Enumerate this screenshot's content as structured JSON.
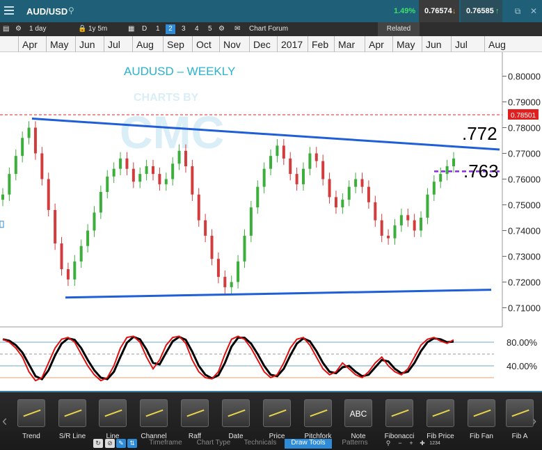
{
  "titlebar": {
    "symbol": "AUD/USD",
    "change": "1.49%",
    "bid": "0.76574",
    "ask": "0.76585"
  },
  "toolbar": {
    "timeframe": "1 day",
    "range": "1y 5m",
    "period_d": "D",
    "period_1": "1",
    "period_2": "2",
    "period_3": "3",
    "period_4": "4",
    "period_5": "5",
    "chart_forum": "Chart Forum",
    "related": "Related"
  },
  "months": [
    "Apr",
    "May",
    "Jun",
    "Jul",
    "Aug",
    "Sep",
    "Oct",
    "Nov",
    "Dec",
    "2017",
    "Feb",
    "Mar",
    "Apr",
    "May",
    "Jun",
    "Jul",
    "Aug"
  ],
  "chart": {
    "title": "AUDUSD – WEEKLY",
    "watermark": "CHARTS BY",
    "watermark_logo": "CMC",
    "annotation_upper": ".772",
    "annotation_lower": ".763",
    "current_price_label": "0.78501",
    "y_labels": [
      "0.80000",
      "0.79000",
      "0.78000",
      "0.77000",
      "0.76000",
      "0.75000",
      "0.74000",
      "0.73000",
      "0.72000",
      "0.71000"
    ],
    "osc_labels": [
      "80.00%",
      "40.00%"
    ],
    "colors": {
      "trendline": "#1e5fd8",
      "support_dashed": "#8a2be2",
      "bull": "#3cae3c",
      "bear": "#d23c3c",
      "price_line": "#e02020"
    }
  },
  "chart_data": {
    "type": "candlestick",
    "title": "AUDUSD – WEEKLY",
    "ylim": [
      0.705,
      0.805
    ],
    "resistance_line": {
      "start": 0.7835,
      "end": 0.7715
    },
    "support_line": {
      "start": 0.714,
      "end": 0.717
    },
    "dashed_level": 0.763,
    "current_price": 0.78501,
    "closes": [
      0.754,
      0.762,
      0.769,
      0.776,
      0.78,
      0.77,
      0.76,
      0.748,
      0.735,
      0.725,
      0.721,
      0.728,
      0.734,
      0.74,
      0.747,
      0.755,
      0.761,
      0.764,
      0.768,
      0.764,
      0.759,
      0.762,
      0.765,
      0.762,
      0.758,
      0.76,
      0.766,
      0.771,
      0.765,
      0.754,
      0.744,
      0.738,
      0.729,
      0.722,
      0.718,
      0.72,
      0.728,
      0.738,
      0.749,
      0.757,
      0.764,
      0.769,
      0.773,
      0.768,
      0.762,
      0.758,
      0.764,
      0.77,
      0.767,
      0.76,
      0.753,
      0.749,
      0.752,
      0.757,
      0.76,
      0.757,
      0.751,
      0.744,
      0.738,
      0.737,
      0.742,
      0.746,
      0.744,
      0.74,
      0.745,
      0.754,
      0.759,
      0.762,
      0.765,
      0.768
    ],
    "oscillator_levels": [
      80,
      40
    ],
    "oscillator_values": [
      85,
      80,
      70,
      55,
      30,
      15,
      20,
      45,
      70,
      85,
      88,
      80,
      60,
      40,
      25,
      15,
      20,
      40,
      70,
      88,
      90,
      80,
      55,
      35,
      50,
      75,
      88,
      90,
      78,
      50,
      30,
      20,
      18,
      30,
      60,
      85,
      90,
      85,
      70,
      50,
      30,
      20,
      25,
      45,
      70,
      85,
      88,
      75,
      55,
      35,
      25,
      30,
      45,
      35,
      25,
      20,
      30,
      45,
      55,
      40,
      30,
      25,
      35,
      55,
      75,
      85,
      88,
      82,
      78,
      84
    ]
  },
  "drawtools": {
    "tools": [
      "Trend",
      "S/R Line",
      "Line",
      "Channel",
      "Raff",
      "Date",
      "Price",
      "Pitchfork",
      "Note",
      "Fibonacci",
      "Fib Price",
      "Fib Fan",
      "Fib A"
    ],
    "badge": "1234",
    "note_icon": "ABC",
    "tabs": [
      "Timeframe",
      "Chart Type",
      "Technicals",
      "Draw Tools",
      "Patterns"
    ],
    "active_tab": "Draw Tools"
  }
}
